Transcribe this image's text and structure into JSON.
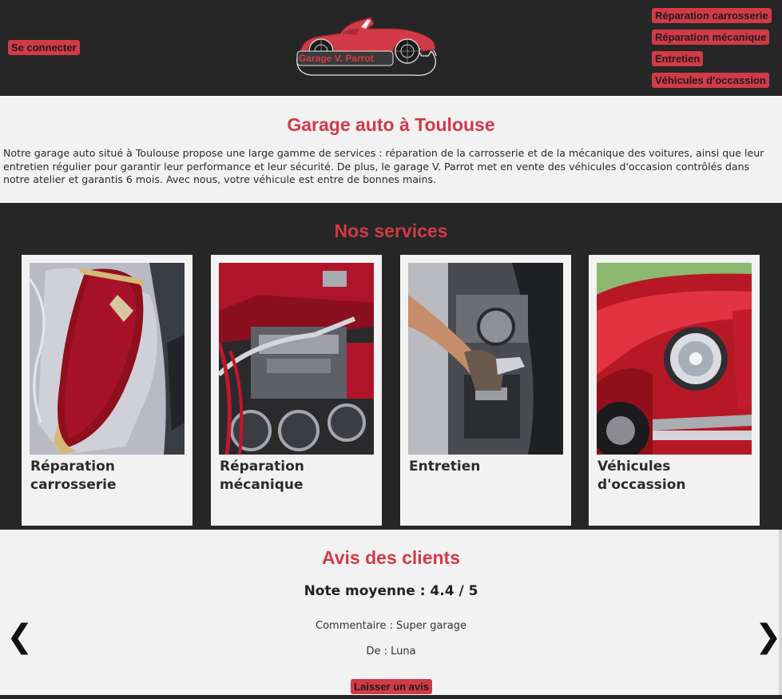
{
  "header": {
    "login_label": "Se connecter",
    "logo_text": "Garage V. Parrot",
    "nav": [
      {
        "label": "Réparation carrosserie"
      },
      {
        "label": "Réparation mécanique"
      },
      {
        "label": "Entretien"
      },
      {
        "label": "Véhicules d'occassion"
      }
    ]
  },
  "intro": {
    "title": "Garage auto à Toulouse",
    "text": "Notre garage auto situé à Toulouse propose une large gamme de services : réparation de la carrosserie et de la mécanique des voitures, ainsi que leur entretien régulier pour garantir leur performance et leur sécurité. De plus, le garage V. Parrot met en vente des véhicules d'occasion contrôlés dans notre atelier et garantis 6 mois. Avec nous, votre véhicule est entre de bonnes mains."
  },
  "services": {
    "title": "Nos services",
    "cards": [
      {
        "title": "Réparation carrosserie",
        "image": "bodywork-photo"
      },
      {
        "title": "Réparation mécanique",
        "image": "engine-photo"
      },
      {
        "title": "Entretien",
        "image": "maintenance-photo"
      },
      {
        "title": "Véhicules d'occassion",
        "image": "red-car-photo"
      }
    ]
  },
  "reviews": {
    "title": "Avis des clients",
    "average": "Note moyenne : 4.4 / 5",
    "comment": "Commentaire : Super garage",
    "author": "De : Luna",
    "leave_review_label": "Laisser un avis",
    "prev_arrow": "❮",
    "next_arrow": "❯"
  },
  "colors": {
    "accent": "#d23a47",
    "dark": "#262626",
    "light": "#f2f2f2"
  }
}
